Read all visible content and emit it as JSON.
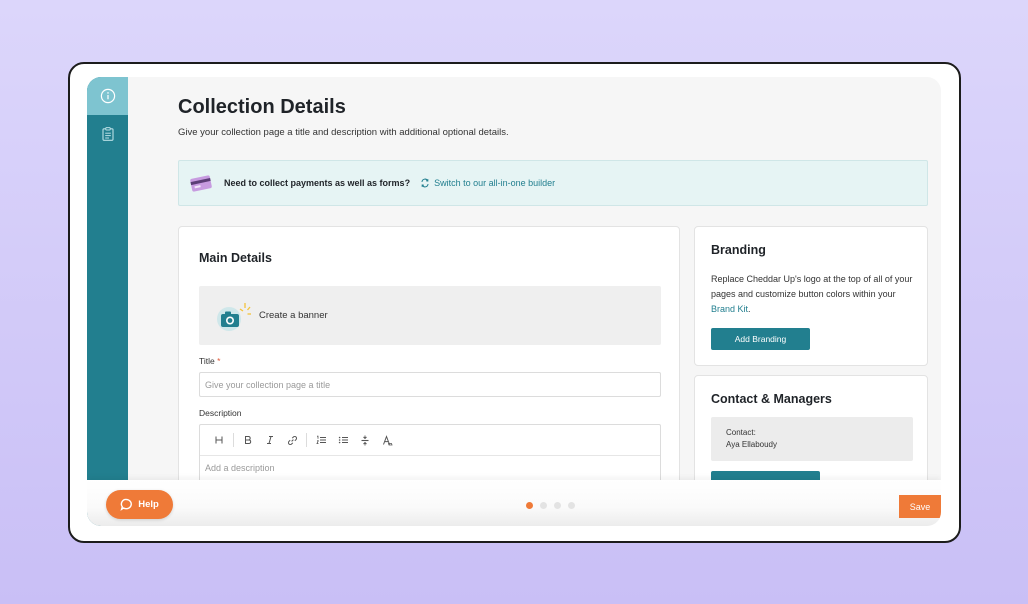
{
  "sidebar": {
    "items": [
      {
        "icon": "info-icon",
        "active": true
      },
      {
        "icon": "clipboard-icon",
        "active": false
      }
    ]
  },
  "header": {
    "title": "Collection Details",
    "subtitle": "Give your collection page a title and description with additional optional details."
  },
  "notice": {
    "text": "Need to collect payments as well as forms?",
    "link": "Switch to our all-in-one builder"
  },
  "main_details": {
    "heading": "Main Details",
    "banner_label": "Create a banner",
    "title_label": "Title",
    "title_required": "*",
    "title_placeholder": "Give your collection page a title",
    "description_label": "Description",
    "description_placeholder": "Add a description",
    "toolbar": [
      "H",
      "B",
      "I",
      "link",
      "ordered-list",
      "bullet-list",
      "divider",
      "clear-format"
    ]
  },
  "branding": {
    "heading": "Branding",
    "body_prefix": "Replace Cheddar Up's logo at the top of all of your pages and customize button colors within your",
    "link": "Brand Kit",
    "body_suffix": ".",
    "button": "Add Branding"
  },
  "contact": {
    "heading": "Contact & Managers",
    "label": "Contact:",
    "name": "Aya Ellaboudy"
  },
  "footer": {
    "steps_total": 4,
    "active_step": 1,
    "save": "Save"
  },
  "help": {
    "label": "Help"
  },
  "colors": {
    "teal": "#227f8f",
    "teal_light": "#7ec4d0",
    "orange": "#ef7a38",
    "notice_bg": "#e6f4f4",
    "background": "#d3cbf8"
  }
}
